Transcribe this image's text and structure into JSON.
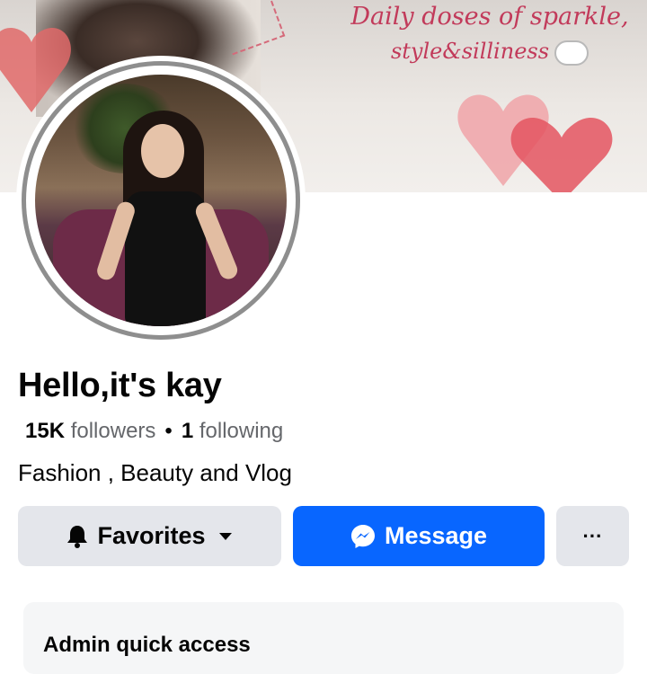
{
  "cover": {
    "text_line1": "Daily doses of sparkle,",
    "text_line2": "style&silliness"
  },
  "profile": {
    "name": "Hello,it's kay",
    "followers_count": "15K",
    "followers_label": "followers",
    "following_count": "1",
    "following_label": "following",
    "bio": "Fashion , Beauty and Vlog"
  },
  "actions": {
    "favorites_label": "Favorites",
    "message_label": "Message",
    "more_label": "···"
  },
  "admin": {
    "title": "Admin quick access"
  },
  "colors": {
    "primary": "#0866ff",
    "secondary_button": "#e4e6eb",
    "cover_text": "#c23a5a"
  },
  "icons": {
    "favorites": "bell-icon",
    "favorites_caret": "caret-down-icon",
    "message": "messenger-icon",
    "more": "more-dots-icon"
  }
}
